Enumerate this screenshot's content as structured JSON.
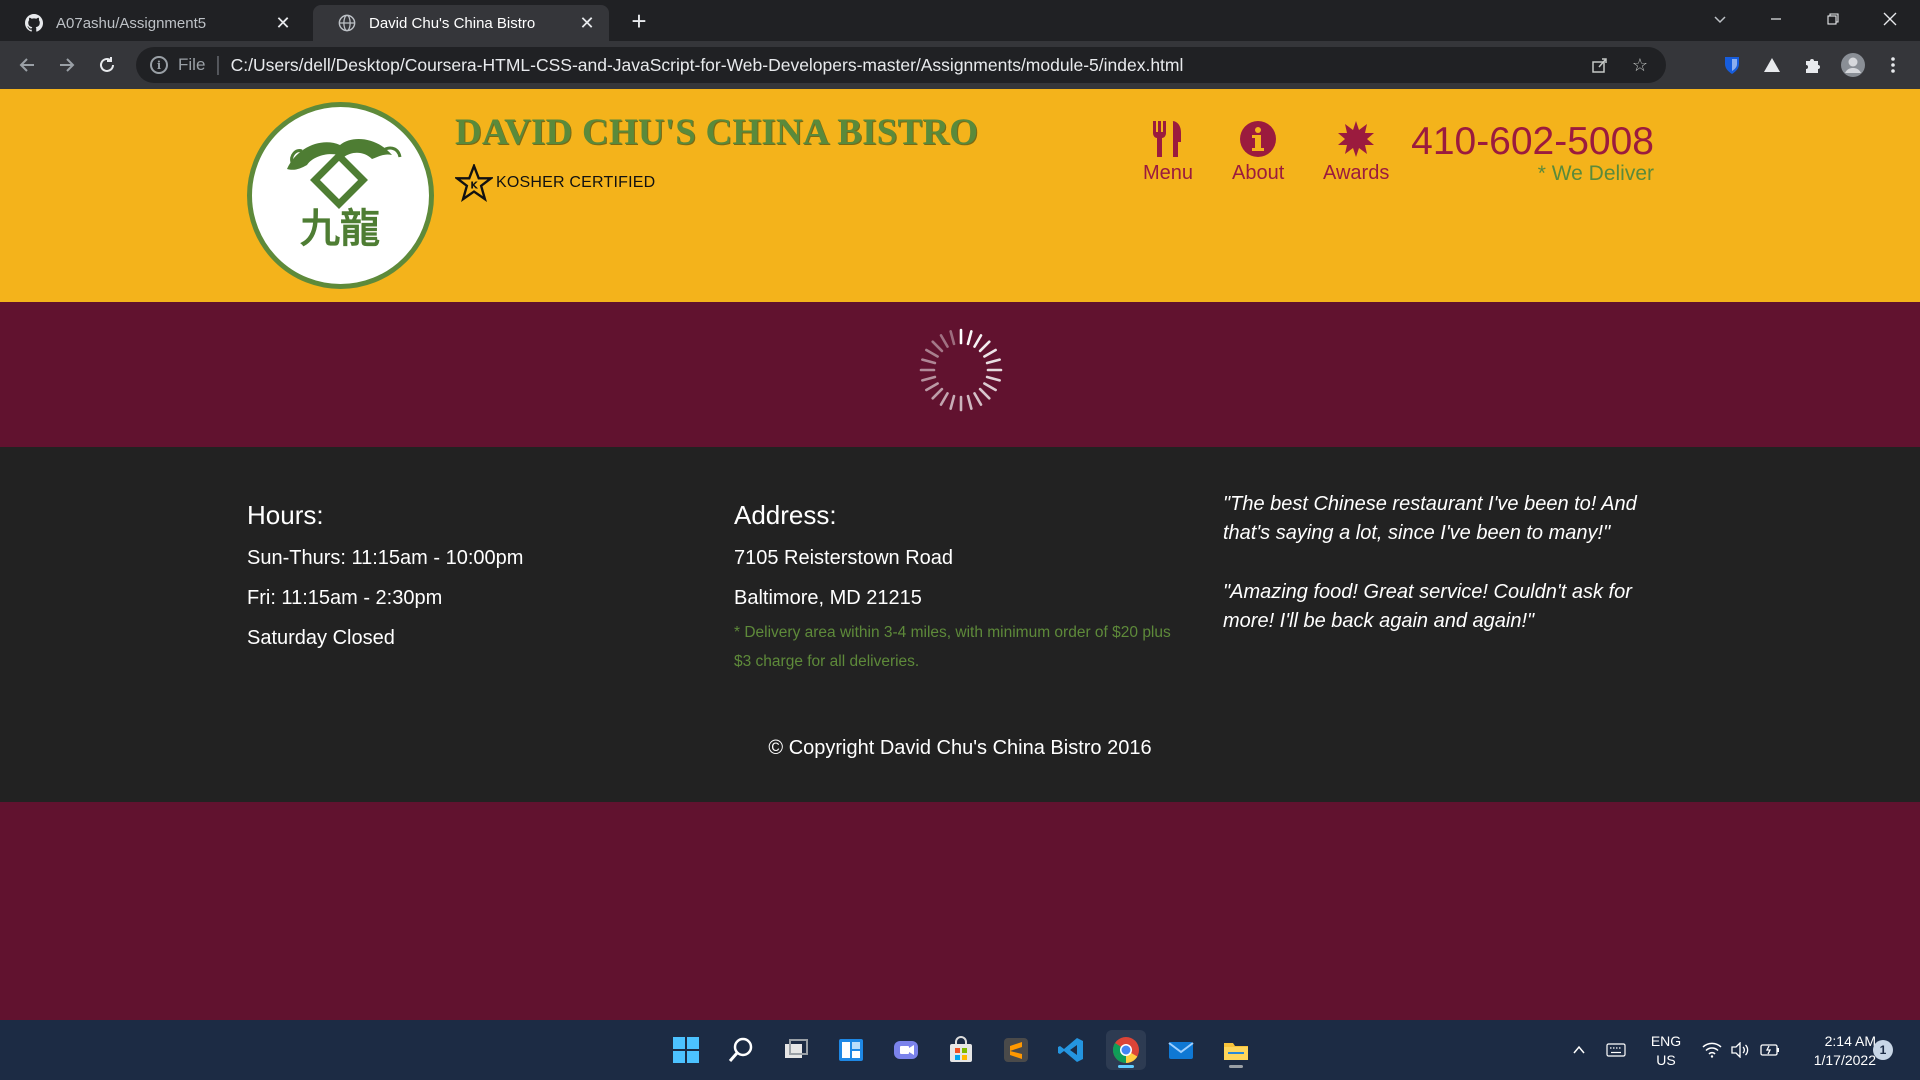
{
  "browser": {
    "tabs": [
      {
        "title": "A07ashu/Assignment5",
        "icon": "github-icon",
        "active": false
      },
      {
        "title": "David Chu's China Bistro",
        "icon": "globe-icon",
        "active": true
      }
    ],
    "omnibox": {
      "scheme_label": "File",
      "url": "C:/Users/dell/Desktop/Coursera-HTML-CSS-and-JavaScript-for-Web-Developers-master/Assignments/module-5/index.html"
    }
  },
  "header": {
    "brand_name": "DAVID CHU'S CHINA BISTRO",
    "kosher_label": "KOSHER CERTIFIED",
    "logo_glyphs": "九龍",
    "nav": [
      {
        "label": "Menu",
        "icon": "cutlery-icon"
      },
      {
        "label": "About",
        "icon": "info-icon"
      },
      {
        "label": "Awards",
        "icon": "award-icon"
      }
    ],
    "phone": "410-602-5008",
    "deliver_note": "* We Deliver"
  },
  "main": {
    "loading_icon": "spinner-icon"
  },
  "footer": {
    "hours": {
      "heading": "Hours:",
      "lines": [
        "Sun-Thurs: 11:15am - 10:00pm",
        "Fri: 11:15am - 2:30pm",
        "Saturday Closed"
      ]
    },
    "address": {
      "heading": "Address:",
      "lines": [
        "7105 Reisterstown Road",
        "Baltimore, MD 21215"
      ],
      "note": "* Delivery area within 3-4 miles, with minimum order of $20 plus $3 charge for all deliveries."
    },
    "testimonials": [
      "\"The best Chinese restaurant I've been to! And that's saying a lot, since I've been to many!\"",
      "\"Amazing food! Great service! Couldn't ask for more! I'll be back again and again!\""
    ],
    "copyright": "© Copyright David Chu's China Bistro 2016"
  },
  "taskbar": {
    "apps": [
      "start-icon",
      "search-icon",
      "task-view-icon",
      "widgets-icon",
      "teams-chat-icon",
      "store-icon",
      "sublime-text-icon",
      "vscode-icon",
      "chrome-icon",
      "mail-icon",
      "file-explorer-icon"
    ],
    "language": {
      "line1": "ENG",
      "line2": "US"
    },
    "time": "2:14 AM",
    "date": "1/17/2022",
    "notification_count": "1"
  },
  "colors": {
    "header_bg": "#f4b31b",
    "brand_green": "#5a8a3b",
    "accent_maroon": "#61122f",
    "nav_red": "#9b1b3e",
    "footer_bg": "#222222"
  }
}
